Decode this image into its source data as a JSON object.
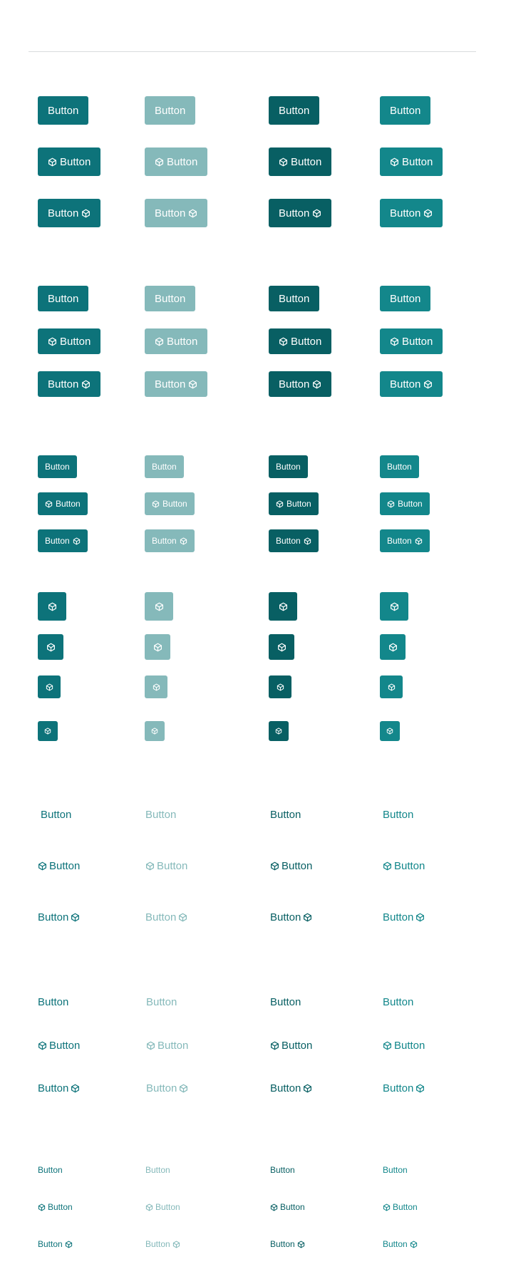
{
  "button_label": "Button",
  "icon_name": "cube-icon",
  "colors": {
    "default": "#0d737a",
    "disabled": "#85b9ba",
    "active": "#085f63",
    "hover": "#13878b"
  }
}
